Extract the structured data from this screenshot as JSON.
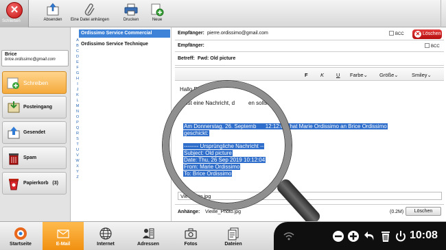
{
  "toolbar": {
    "close_label": "Schließen",
    "send_label": "Absenden",
    "attach_label": "Eine Datei anhängen",
    "print_label": "Drucken",
    "new_label": "Neue"
  },
  "user": {
    "name": "Brice",
    "email": "brice.ordissimo@gmail.com"
  },
  "folders": [
    {
      "label": "Schreiben",
      "active": true
    },
    {
      "label": "Posteingang"
    },
    {
      "label": "Gesendet"
    },
    {
      "label": "Spam"
    },
    {
      "label": "Papierkorb",
      "count": "(3)"
    }
  ],
  "alphabet": [
    "A",
    "B",
    "C",
    "D",
    "E",
    "F",
    "G",
    "H",
    "I",
    "J",
    "K",
    "L",
    "M",
    "N",
    "O",
    "P",
    "Q",
    "R",
    "S",
    "T",
    "U",
    "V",
    "W",
    "X",
    "Y",
    "Z"
  ],
  "contacts": [
    {
      "name": "Ordissimo Service Commercial",
      "selected": true
    },
    {
      "name": "Ordissimo Service Technique"
    }
  ],
  "compose": {
    "to_label": "Empfänger:",
    "to_value": "pierre.ordissimo@gmail.com",
    "cc_label": "Empfänger:",
    "cc_value": "",
    "bcc_label": "BCC",
    "delete_label": "Löschen",
    "subject_label": "Betreff:",
    "subject_value": "Fwd: Old picture",
    "format": {
      "bold": "F",
      "italic": "K",
      "underline": "U",
      "color": "Farbe",
      "size": "Größe",
      "smiley": "Smiley"
    },
    "body": {
      "greeting": "Hallo Pi",
      "line1": "Hi ist eine Nachricht, d",
      "line1_end": "en sollst.",
      "quote1": "Am Donnerstag, 26. Septemb",
      "quote1_end": "12:12:04, hat Marie Ordissimo an Brice Ordissimo",
      "quote2": "geschickt:",
      "quote3": "-------- Ursprüngliche Nachricht --",
      "quote4": "Subject: Old picture",
      "quote5": "Date: Thu, 26 Sep 2019 10:12:04",
      "quote6": "From: Marie Ordissimo",
      "quote7": "To: Brice Ordissimo",
      "attachment_preview": "Vie   Photo.jpg"
    },
    "attachment": {
      "label": "Anhänge:",
      "file": "Vieille_Photo.jpg",
      "size": "(0.2M)",
      "remove_label": "Löschen"
    }
  },
  "bottom_nav": [
    {
      "label": "Startseite"
    },
    {
      "label": "E-Mail",
      "active": true
    },
    {
      "label": "Internet"
    },
    {
      "label": "Adressen"
    },
    {
      "label": "Fotos"
    },
    {
      "label": "Dateien"
    }
  ],
  "clock": "10:08",
  "colors": {
    "accent_orange": "#f5a623",
    "selection_blue": "#2f6fcb",
    "delete_red": "#c41212"
  }
}
